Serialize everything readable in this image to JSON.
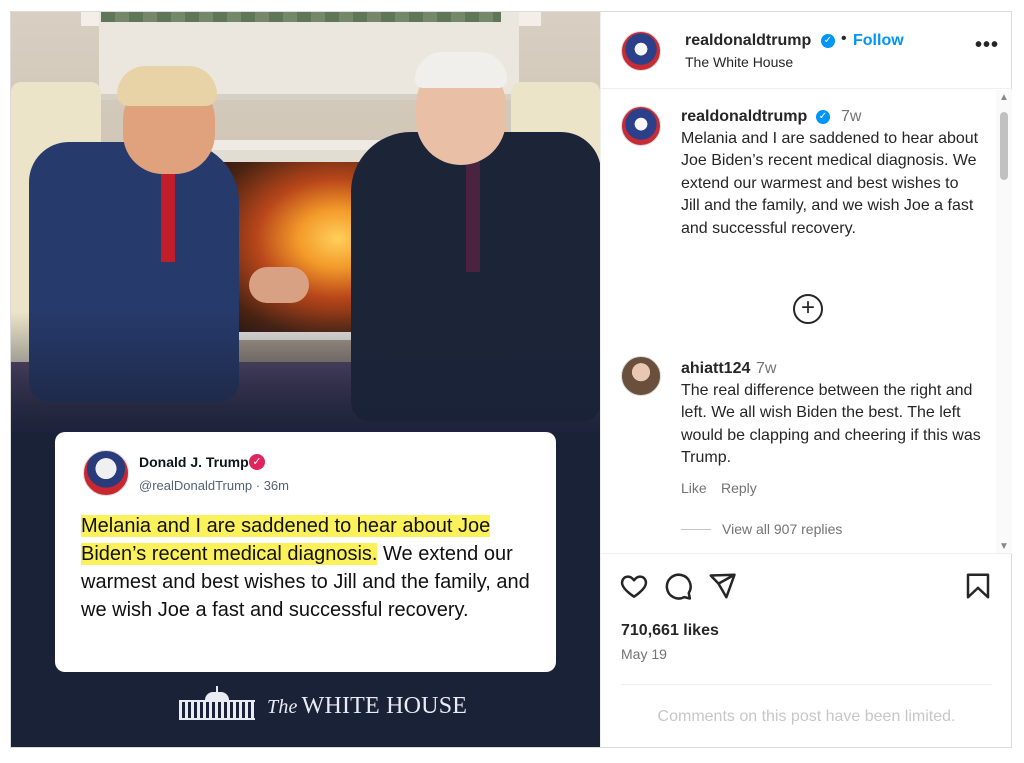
{
  "post": {
    "username": "realdonaldtrump",
    "follow_label": "Follow",
    "subtitle": "The White House",
    "more_label": "•••"
  },
  "media": {
    "tweet": {
      "name": "Donald J. Trump",
      "handle_time": "@realDonaldTrump · 36m",
      "text_highlight": "Melania and I are saddened to hear about Joe Biden’s recent medical diagnosis.",
      "text_rest": " We extend our warmest and best wishes to Jill and the family, and we wish Joe a fast and successful recovery."
    },
    "brand_the": "The",
    "brand_name": "WHITE HOUSE"
  },
  "caption": {
    "username": "realdonaldtrump",
    "time": "7w",
    "text": "Melania and I are saddened to hear about Joe Biden’s recent medical diagnosis. We extend our warmest and best wishes to Jill and the family, and we wish Joe a fast and successful recovery."
  },
  "comment": {
    "username": "ahiatt124",
    "time": "7w",
    "text": "The real difference between the right and left. We all wish Biden the best. The left would be clapping and cheering if this was Trump.",
    "like_label": "Like",
    "reply_label": "Reply",
    "view_replies": "View all 907 replies"
  },
  "stats": {
    "likes": "710,661 likes",
    "date": "May 19"
  },
  "comments_limited": "Comments on this post have been limited.",
  "icons": [
    "verified-icon",
    "add-circle-icon",
    "heart-icon",
    "comment-icon",
    "share-icon",
    "bookmark-icon",
    "more-icon"
  ],
  "colors": {
    "accent": "#0095f6",
    "highlight": "#fbf15b",
    "media_bg": "#1a2238"
  }
}
